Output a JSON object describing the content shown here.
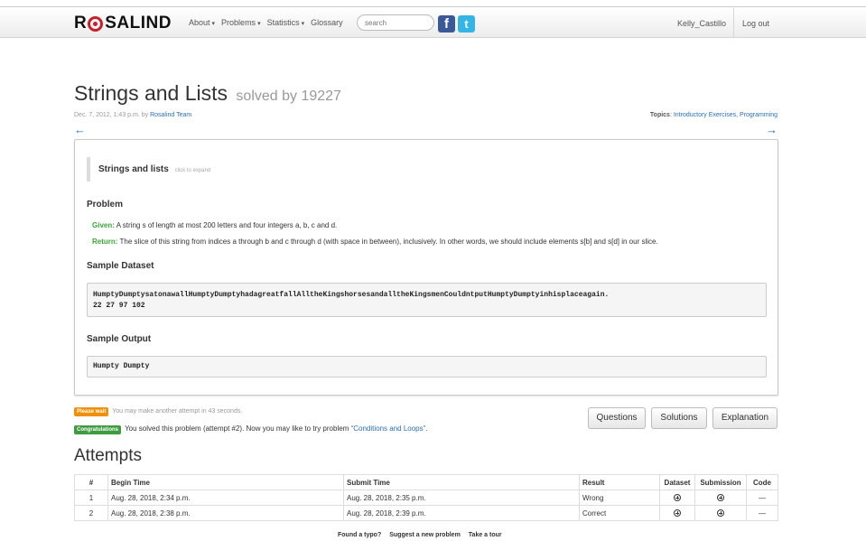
{
  "nav": {
    "logo_left": "R",
    "logo_right": "SALIND",
    "items": [
      "About",
      "Problems",
      "Statistics",
      "Glossary"
    ],
    "search_placeholder": "search",
    "facebook": "f",
    "twitter": "t",
    "user": "Kelly_Castillo",
    "logout": "Log out"
  },
  "problem": {
    "title": "Strings and Lists",
    "solved_by": "solved by 19227",
    "date": "Dec. 7, 2012, 1:43 p.m. by",
    "author": "Rosalind Team",
    "topics_label": "Topics",
    "topics": [
      "Introductory Exercises",
      "Programming"
    ],
    "prev_arrow": "←",
    "next_arrow": "→",
    "expander_title": "Strings and lists",
    "expander_hint": "click to expand",
    "heading": "Problem",
    "given_label": "Given:",
    "given_text": "A string s of length at most 200 letters and four integers a, b, c and d.",
    "return_label": "Return:",
    "return_text": "The slice of this string from indices a through b and c through d (with space in between), inclusively. In other words, we should include elements s[b] and s[d] in our slice.",
    "dataset_heading": "Sample Dataset",
    "dataset": "HumptyDumptysatonawallHumptyDumptyhadagreatfallAlltheKingshorsesandalltheKingsmenCouldntputHumptyDumptyinhisplaceagain.\n22 27 97 102",
    "output_heading": "Sample Output",
    "output": "Humpty Dumpty"
  },
  "notices": {
    "wait_badge": "Please wait",
    "wait_text": "You may make another attempt in 43 seconds.",
    "congrats_badge": "Congratulations",
    "congrats_text": "You solved this problem (attempt #2). Now you may like to try problem",
    "next_problem": "“Conditions and Loops”",
    "period": "."
  },
  "buttons": {
    "questions": "Questions",
    "solutions": "Solutions",
    "explanation": "Explanation"
  },
  "attempts": {
    "heading": "Attempts",
    "columns": [
      "#",
      "Begin Time",
      "Submit Time",
      "Result",
      "Dataset",
      "Submission",
      "Code"
    ],
    "rows": [
      {
        "num": "1",
        "begin": "Aug. 28, 2018, 2:34 p.m.",
        "submit": "Aug. 28, 2018, 2:35 p.m.",
        "result": "Wrong",
        "code": "—"
      },
      {
        "num": "2",
        "begin": "Aug. 28, 2018, 2:38 p.m.",
        "submit": "Aug. 28, 2018, 2:39 p.m.",
        "result": "Correct",
        "code": "—"
      }
    ]
  },
  "footer": {
    "typo": "Found a typo?",
    "suggest": "Suggest a new problem",
    "tour": "Take a tour"
  }
}
